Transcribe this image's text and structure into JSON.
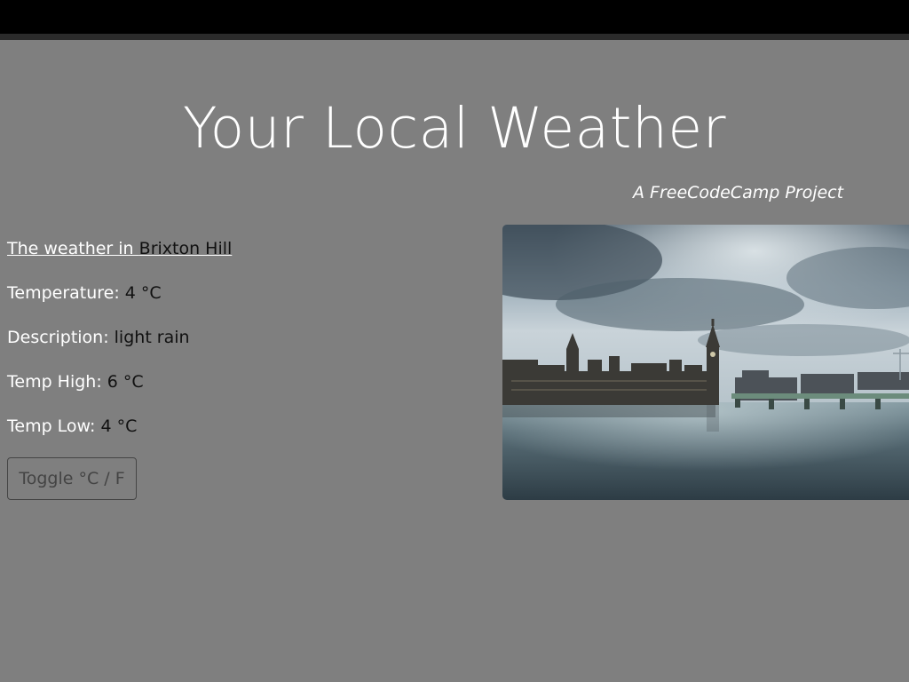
{
  "header": {
    "title": "Your Local Weather",
    "subtitle": "A FreeCodeCamp Project"
  },
  "weather": {
    "link_prefix": "The weather in ",
    "city": "Brixton Hill",
    "temperature_label": "Temperature: ",
    "temperature_value": "4 °C",
    "description_label": "Description: ",
    "description_value": "light rain",
    "high_label": "Temp High: ",
    "high_value": "6 °C",
    "low_label": "Temp Low: ",
    "low_value": "4 °C"
  },
  "controls": {
    "toggle_label": "Toggle °C / F"
  },
  "image": {
    "icon": "london-westminster-photo"
  },
  "colors": {
    "background": "#7f7f7f",
    "text_light": "#ffffff",
    "text_dark": "#111111",
    "top_bar": "#000000"
  }
}
